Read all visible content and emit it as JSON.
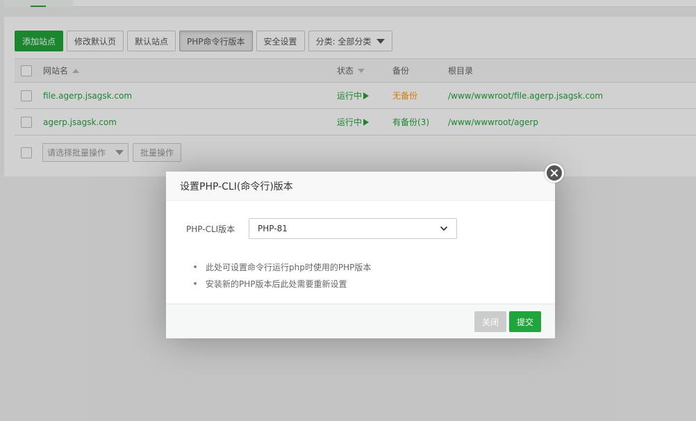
{
  "toolbar": {
    "add_site": "添加站点",
    "modify_default_page": "修改默认页",
    "default_site": "默认站点",
    "php_cli_version": "PHP命令行版本",
    "security_settings": "安全设置",
    "category_filter": "分类: 全部分类"
  },
  "table": {
    "headers": {
      "site_name": "网站名",
      "status": "状态",
      "backup": "备份",
      "root_dir": "根目录"
    },
    "rows": [
      {
        "name": "file.agerp.jsagsk.com",
        "status": "运行中",
        "backup": "无备份",
        "root": "/www/wwwroot/file.agerp.jsagsk.com"
      },
      {
        "name": "agerp.jsagsk.com",
        "status": "运行中",
        "backup": "有备份(3)",
        "root": "/www/wwwroot/agerp"
      }
    ]
  },
  "batch": {
    "select_placeholder": "请选择批量操作",
    "batch_button": "批量操作"
  },
  "dialog": {
    "title": "设置PHP-CLI(命令行)版本",
    "field_label": "PHP-CLI版本",
    "selected_version": "PHP-81",
    "tips": [
      "此处可设置命令行运行php时使用的PHP版本",
      "安装新的PHP版本后此处需要重新设置"
    ],
    "close_button": "关闭",
    "submit_button": "提交"
  },
  "colors": {
    "accent": "#20a53a",
    "warning": "#ff9900"
  },
  "icons": {
    "close": "close-icon",
    "sort_asc": "sort-asc-icon",
    "sort_desc": "sort-desc-icon",
    "running": "play-icon",
    "dropdown": "chevron-down-icon"
  }
}
